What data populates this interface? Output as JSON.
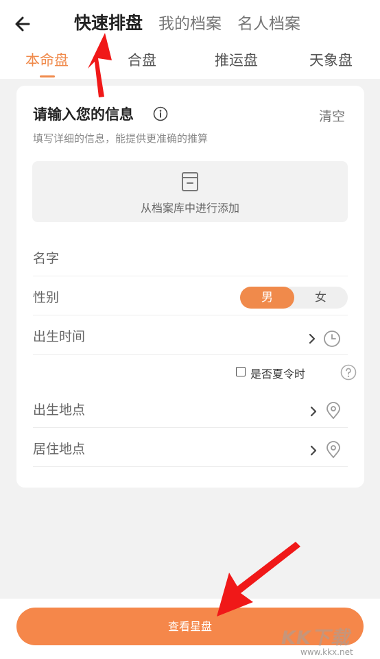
{
  "header": {
    "top_tabs": [
      "快速排盘",
      "我的档案",
      "名人档案"
    ],
    "active_top_tab": "快速排盘",
    "sub_tabs": [
      "本命盘",
      "合盘",
      "推运盘",
      "天象盘"
    ],
    "active_sub_tab": "本命盘",
    "accent_color": "#f08a4b"
  },
  "card": {
    "title": "请输入您的信息",
    "clear_label": "清空",
    "subtitle": "填写详细的信息，能提供更准确的推算",
    "archive_label": "从档案库中进行添加",
    "fields": {
      "name_label": "名字",
      "gender_label": "性别",
      "gender_options": [
        "男",
        "女"
      ],
      "gender_selected": "男",
      "birth_time_label": "出生时间",
      "dst_label": "是否夏令时",
      "dst_checked": false,
      "birth_place_label": "出生地点",
      "residence_label": "居住地点"
    }
  },
  "primary_button": {
    "label": "查看星盘"
  },
  "watermark": {
    "text": "KK下载",
    "url": "www.kkx.net"
  },
  "icons": {
    "back": "back-arrow-icon",
    "info": "info-icon",
    "archive": "archive-box-icon",
    "clock": "clock-icon",
    "help": "question-circle-icon",
    "location": "location-pin-icon",
    "chevron": "chevron-right-icon"
  }
}
